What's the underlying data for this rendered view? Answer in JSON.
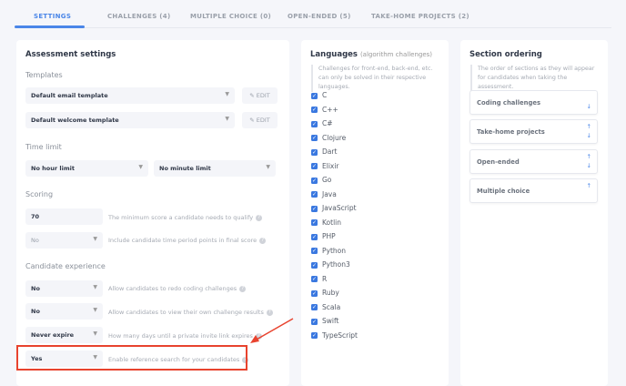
{
  "tabs": [
    {
      "label": "SETTINGS",
      "active": true
    },
    {
      "label": "CHALLENGES (4)"
    },
    {
      "label": "MULTIPLE CHOICE (0)"
    },
    {
      "label": "OPEN-ENDED (5)"
    },
    {
      "label": "TAKE-HOME PROJECTS (2)"
    }
  ],
  "assessment": {
    "title": "Assessment settings",
    "templates_label": "Templates",
    "email_template": "Default email template",
    "welcome_template": "Default welcome template",
    "edit_label": "EDIT",
    "time_limit_label": "Time limit",
    "hour_limit": "No hour limit",
    "minute_limit": "No minute limit",
    "scoring_label": "Scoring",
    "min_score": "70",
    "min_score_desc": "The minimum score a candidate needs to qualify",
    "time_points": "No",
    "time_points_desc": "Include candidate time period points in final score",
    "candidate_label": "Candidate experience",
    "redo": "No",
    "redo_desc": "Allow candidates to redo coding challenges",
    "view_results": "No",
    "view_results_desc": "Allow candidates to view their own challenge results",
    "expire": "Never expire",
    "expire_desc": "How many days until a private invite link expires",
    "reference": "Yes",
    "reference_desc": "Enable reference search for your candidates"
  },
  "languages": {
    "title": "Languages",
    "subtitle": "(algorithm challenges)",
    "note": "Challenges for front-end, back-end, etc. can only be solved in their respective languages.",
    "items": [
      "C",
      "C++",
      "C#",
      "Clojure",
      "Dart",
      "Elixir",
      "Go",
      "Java",
      "JavaScript",
      "Kotlin",
      "PHP",
      "Python",
      "Python3",
      "R",
      "Ruby",
      "Scala",
      "Swift",
      "TypeScript"
    ]
  },
  "ordering": {
    "title": "Section ordering",
    "note": "The order of sections as they will appear for candidates when taking the assessment.",
    "sections": [
      {
        "label": "Coding challenges",
        "up": false,
        "down": true
      },
      {
        "label": "Take-home projects",
        "up": true,
        "down": true
      },
      {
        "label": "Open-ended",
        "up": true,
        "down": true
      },
      {
        "label": "Multiple choice",
        "up": true,
        "down": false
      }
    ]
  },
  "colors": {
    "accent": "#4a86e8",
    "highlight": "#e8432e"
  }
}
